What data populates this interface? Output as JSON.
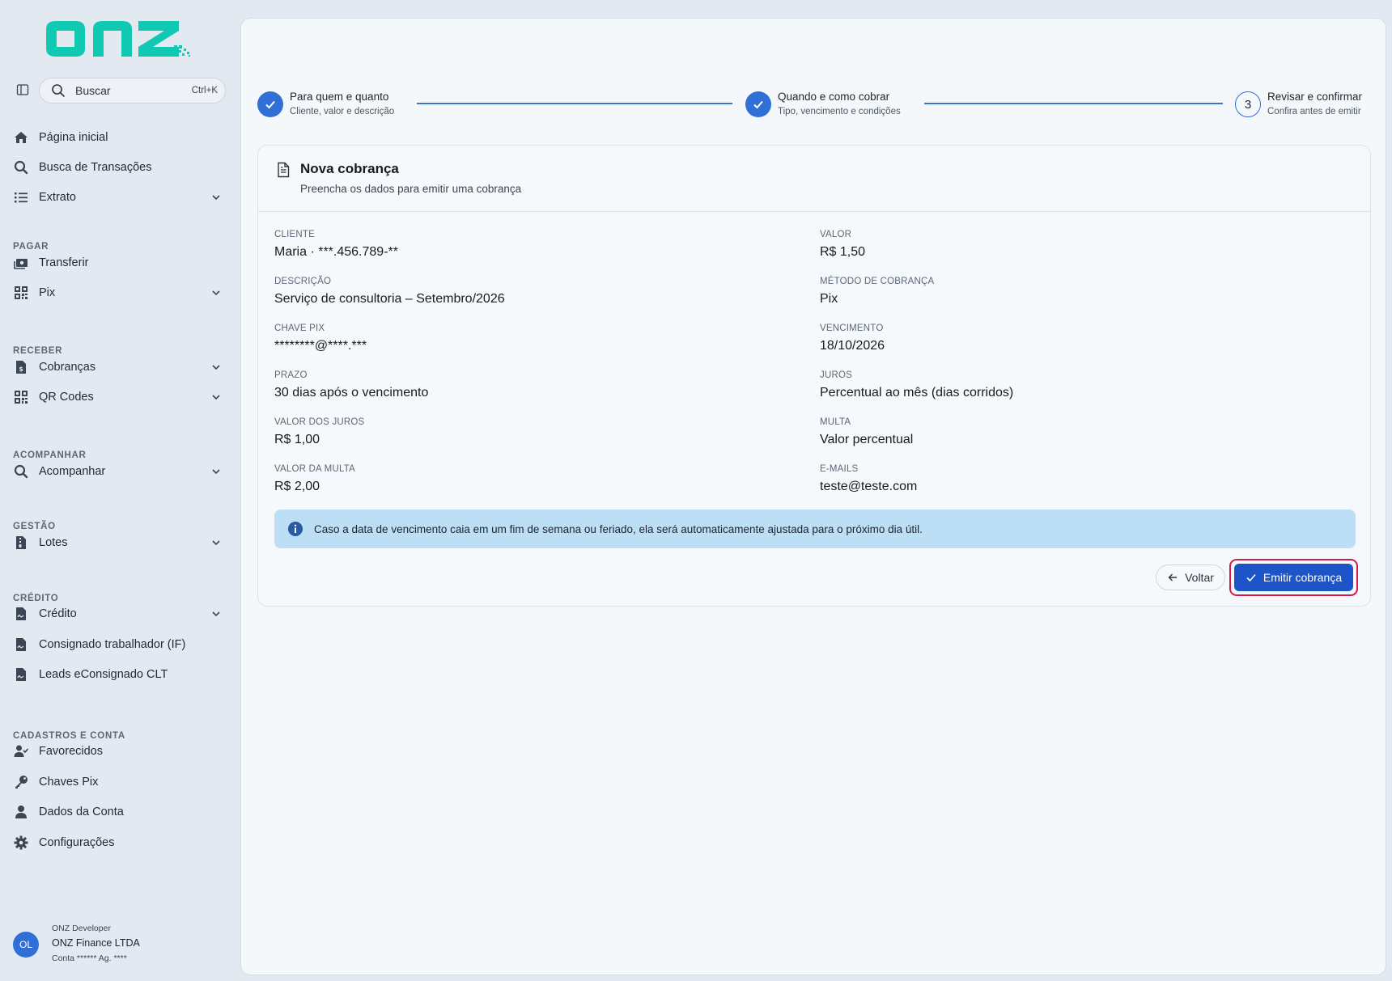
{
  "brand": {
    "logo_text": "onz",
    "accent": "#10c9b3"
  },
  "search": {
    "placeholder": "Buscar",
    "shortcut": "Ctrl+K"
  },
  "nav": {
    "home": "Página inicial",
    "transactions": "Busca de Transações",
    "statement": "Extrato",
    "section_pay": "PAGAR",
    "transfer": "Transferir",
    "pix": "Pix",
    "section_receive": "RECEBER",
    "charges": "Cobranças",
    "qrcodes": "QR Codes",
    "section_track": "ACOMPANHAR",
    "track": "Acompanhar",
    "section_management": "GESTÃO",
    "batches": "Lotes",
    "section_credit": "CRÉDITO",
    "credit": "Crédito",
    "payroll_loan": "Consignado trabalhador (IF)",
    "leads": "Leads eConsignado CLT",
    "section_accounts": "CADASTROS E CONTA",
    "favorites": "Favorecidos",
    "pix_keys": "Chaves Pix",
    "account_data": "Dados da Conta",
    "settings": "Configurações"
  },
  "user": {
    "initials": "OL",
    "role": "ONZ Developer",
    "company": "ONZ Finance LTDA",
    "account": "Conta ****** Ag. ****"
  },
  "stepper": {
    "steps": [
      {
        "title": "Para quem e quanto",
        "subtitle": "Cliente, valor e descrição",
        "status": "done"
      },
      {
        "title": "Quando e como cobrar",
        "subtitle": "Tipo, vencimento e condições",
        "status": "done"
      },
      {
        "number": "3",
        "title": "Revisar e confirmar",
        "subtitle": "Confira antes de emitir",
        "status": "current"
      }
    ]
  },
  "card": {
    "title": "Nova cobrança",
    "subtitle": "Preencha os dados para emitir uma cobrança"
  },
  "fields": {
    "client": {
      "label": "CLIENTE",
      "value": "Maria · ***.456.789-**"
    },
    "amount": {
      "label": "VALOR",
      "value": "R$ 1,50"
    },
    "description": {
      "label": "DESCRIÇÃO",
      "value": "Serviço de consultoria – Setembro/2026"
    },
    "method": {
      "label": "MÉTODO DE COBRANÇA",
      "value": "Pix"
    },
    "pix_key": {
      "label": "CHAVE PIX",
      "value": "********@****.***"
    },
    "due_date": {
      "label": "VENCIMENTO",
      "value": "18/10/2026"
    },
    "term": {
      "label": "PRAZO",
      "value": "30 dias após o vencimento"
    },
    "interest": {
      "label": "JUROS",
      "value": "Percentual ao mês (dias corridos)"
    },
    "interest_value": {
      "label": "VALOR DOS JUROS",
      "value": "R$ 1,00"
    },
    "fine": {
      "label": "MULTA",
      "value": "Valor percentual"
    },
    "fine_value": {
      "label": "VALOR DA MULTA",
      "value": "R$ 2,00"
    },
    "emails": {
      "label": "E-MAILS",
      "value": "teste@teste.com"
    }
  },
  "notice": "Caso a data de vencimento caia em um fim de semana ou feriado, ela será automaticamente ajustada para o próximo dia útil.",
  "actions": {
    "back": "Voltar",
    "submit": "Emitir cobrança"
  },
  "colors": {
    "primary": "#1d54c8",
    "step": "#2f6fd6",
    "highlight": "#d7194a",
    "info_bg": "#bcdff5"
  }
}
